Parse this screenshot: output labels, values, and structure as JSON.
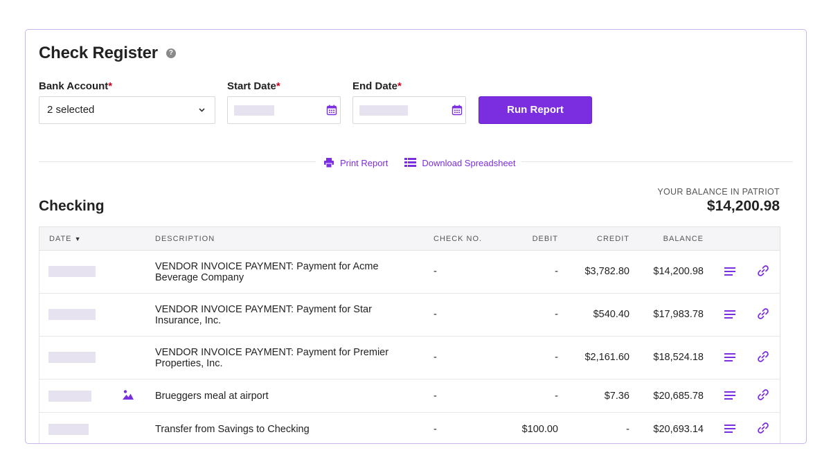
{
  "page": {
    "title": "Check Register",
    "help_icon": "?"
  },
  "filters": {
    "bank_account_label": "Bank Account",
    "bank_account_value": "2 selected",
    "start_date_label": "Start Date",
    "end_date_label": "End Date",
    "required_mark": "*",
    "run_report_label": "Run Report"
  },
  "actions": {
    "print_label": "Print Report",
    "download_label": "Download Spreadsheet"
  },
  "section": {
    "title": "Checking",
    "balance_label": "YOUR BALANCE IN PATRIOT",
    "balance_value": "$14,200.98"
  },
  "table": {
    "columns": {
      "date": "DATE",
      "description": "DESCRIPTION",
      "check_no": "CHECK NO.",
      "debit": "DEBIT",
      "credit": "CREDIT",
      "balance": "BALANCE"
    },
    "sort_indicator": "▼",
    "rows": [
      {
        "description": "VENDOR INVOICE PAYMENT: Payment for Acme Beverage Company",
        "check_no": "-",
        "debit": "-",
        "credit": "$3,782.80",
        "balance": "$14,200.98",
        "has_attachment": false
      },
      {
        "description": "VENDOR INVOICE PAYMENT: Payment for Star Insurance, Inc.",
        "check_no": "-",
        "debit": "-",
        "credit": "$540.40",
        "balance": "$17,983.78",
        "has_attachment": false
      },
      {
        "description": "VENDOR INVOICE PAYMENT: Payment for Premier Properties, Inc.",
        "check_no": "-",
        "debit": "-",
        "credit": "$2,161.60",
        "balance": "$18,524.18",
        "has_attachment": false
      },
      {
        "description": "Brueggers meal at airport",
        "check_no": "-",
        "debit": "-",
        "credit": "$7.36",
        "balance": "$20,685.78",
        "has_attachment": true
      },
      {
        "description": "Transfer from Savings to Checking",
        "check_no": "-",
        "debit": "$100.00",
        "credit": "-",
        "balance": "$20,693.14",
        "has_attachment": false
      }
    ]
  },
  "colors": {
    "accent": "#7b2ee0",
    "required": "#d0021b",
    "placeholder": "#e6e2ef"
  },
  "icons": {
    "help": "question-circle-icon",
    "dropdown": "chevron-down-icon",
    "calendar": "calendar-icon",
    "print": "printer-icon",
    "download": "spreadsheet-icon",
    "details": "lines-icon",
    "link": "link-icon",
    "attachment": "image-icon"
  }
}
